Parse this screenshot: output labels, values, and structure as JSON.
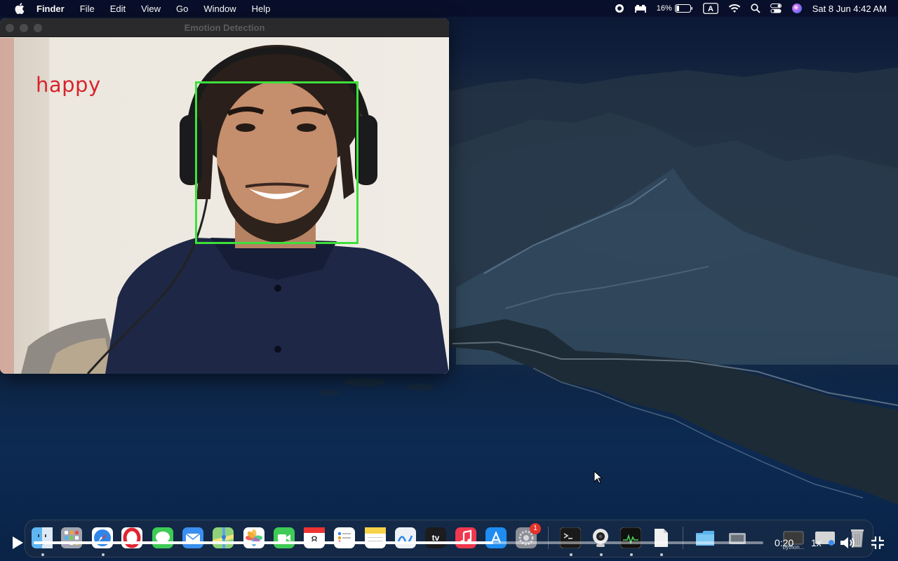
{
  "menubar": {
    "app_name": "Finder",
    "items": [
      "File",
      "Edit",
      "View",
      "Go",
      "Window",
      "Help"
    ],
    "battery_percent": "16%",
    "input_source": "A",
    "datetime": "Sat 8 Jun  4:42 AM",
    "status_icons": [
      "screen-record-icon",
      "display-icon",
      "battery-icon",
      "input-source-icon",
      "wifi-icon",
      "spotlight-search-icon",
      "control-center-icon",
      "siri-icon"
    ]
  },
  "window": {
    "title": "Emotion Detection",
    "emotion_label": "happy",
    "face_box_color": "#3ee03a",
    "label_color": "#d8242c"
  },
  "dock": {
    "apps": [
      {
        "name": "finder",
        "icon": "finder-icon",
        "color": "#3a8ee6"
      },
      {
        "name": "launchpad",
        "icon": "launchpad-icon",
        "color": "#8c8f99"
      },
      {
        "name": "safari",
        "icon": "safari-icon",
        "color": "#2f7de1"
      },
      {
        "name": "opera",
        "icon": "opera-icon",
        "color": "#e0232e"
      },
      {
        "name": "messages",
        "icon": "messages-icon",
        "color": "#2fc447"
      },
      {
        "name": "mail",
        "icon": "mail-icon",
        "color": "#2e86e8"
      },
      {
        "name": "maps",
        "icon": "maps-icon",
        "color": "#4db05e"
      },
      {
        "name": "photos",
        "icon": "photos-icon",
        "color": "#f1f1f1"
      },
      {
        "name": "facetime",
        "icon": "facetime-icon",
        "color": "#2ec24a"
      },
      {
        "name": "calendar",
        "icon": "calendar-icon",
        "color": "#ffffff",
        "label": "8"
      },
      {
        "name": "reminders",
        "icon": "reminders-icon",
        "color": "#f5f5f5"
      },
      {
        "name": "notes",
        "icon": "notes-icon",
        "color": "#f6d24a"
      },
      {
        "name": "freeform",
        "icon": "freeform-icon",
        "color": "#e9eef4"
      },
      {
        "name": "apple-tv",
        "icon": "apple-tv-icon",
        "color": "#1c1c1e",
        "label": "tv"
      },
      {
        "name": "music",
        "icon": "music-icon",
        "color": "#f0384e"
      },
      {
        "name": "app-store",
        "icon": "app-store-icon",
        "color": "#1e8cf0"
      },
      {
        "name": "system-settings",
        "icon": "settings-icon",
        "color": "#7b7e86",
        "badge": "1"
      },
      {
        "name": "terminal",
        "icon": "terminal-icon",
        "color": "#1a1a1a"
      },
      {
        "name": "webcam",
        "icon": "webcam-icon",
        "color": "#dadada"
      },
      {
        "name": "activity-monitor",
        "icon": "activity-monitor-icon",
        "color": "#1b1b1b"
      },
      {
        "name": "document",
        "icon": "document-icon",
        "color": "#e8e8e8"
      },
      {
        "name": "downloads-folder",
        "icon": "folder-icon",
        "color": "#4aa5e6"
      },
      {
        "name": "preview-stack",
        "icon": "preview-icon",
        "color": "#9aa0a8"
      },
      {
        "name": "python-window",
        "icon": "python-window-icon",
        "color": "#3a3a3a",
        "label": "python..."
      },
      {
        "name": "minimized-window",
        "icon": "minimized-window-icon",
        "color": "#c9c9c9"
      },
      {
        "name": "trash",
        "icon": "trash-icon",
        "color": "#a0a4aa"
      }
    ]
  },
  "player": {
    "time": "0:20",
    "speed": "1x",
    "progress": 0.63
  }
}
